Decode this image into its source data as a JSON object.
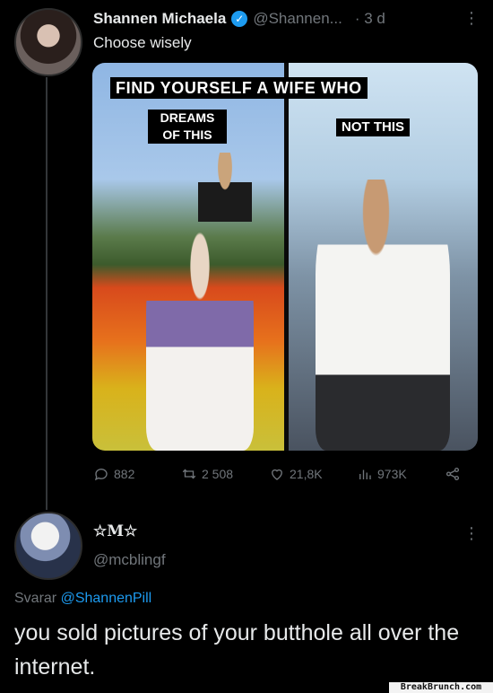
{
  "tweet": {
    "author_name": "Shannen Michaela",
    "handle": "@Shannen...",
    "time": "· 3 d",
    "more": "⋮",
    "text": "Choose wisely",
    "image": {
      "headline": "FIND YOURSELF A WIFE WHO",
      "label_left_line1": "DREAMS",
      "label_left_line2": "OF THIS",
      "label_right": "NOT THIS"
    },
    "stats": {
      "replies": "882",
      "retweets": "2 508",
      "likes": "21,8K",
      "views": "973K"
    }
  },
  "reply": {
    "author_name": "☆M☆",
    "handle": "@mcblingf",
    "more": "⋮",
    "replying_prefix": "Svarar ",
    "replying_to": "@ShannenPill",
    "text": "you sold pictures of your butthole all over the internet."
  },
  "watermark": "BreakBrunch.com",
  "colors": {
    "background": "#000000",
    "link": "#1d9bf0",
    "muted": "#71767b",
    "text": "#e7e9ea"
  },
  "icons": [
    "verified-badge-icon",
    "reply-icon",
    "retweet-icon",
    "like-icon",
    "views-icon",
    "share-icon",
    "more-icon"
  ]
}
